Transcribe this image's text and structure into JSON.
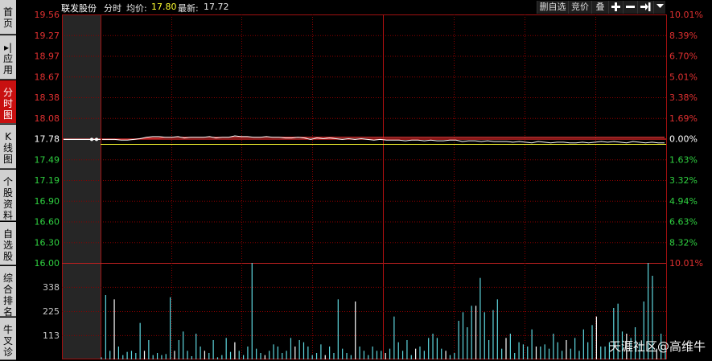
{
  "sidebar": {
    "tabs": [
      {
        "label": "首页",
        "active": false
      },
      {
        "label": "▸|应用",
        "active": false
      },
      {
        "label": "分时图",
        "active": true
      },
      {
        "label": "K线图",
        "active": false
      },
      {
        "label": "个股资料",
        "active": false
      },
      {
        "label": "自选股",
        "active": false
      },
      {
        "label": "综合排名",
        "active": false
      },
      {
        "label": "牛叉诊",
        "active": false
      }
    ]
  },
  "header": {
    "stock_name": "联发股份",
    "mode": "分时",
    "avg_label": "均价:",
    "avg_value": "17.80",
    "latest_label": "最新:",
    "latest_value": "17.72"
  },
  "toolbar": {
    "remove_watch": "删自选",
    "auction": "竞价",
    "overlay": "叠"
  },
  "watermark": "天涯社区@高维牛",
  "colors": {
    "up": "#e03030",
    "down": "#2fd040",
    "axis_white": "#c8c8c8",
    "grid": "#8b0000",
    "price_line": "#ffffff",
    "avg_line": "#ffff30",
    "volume_bar": "#5fd8e0"
  },
  "chart_data": {
    "type": "line",
    "prev_close": 17.78,
    "price_axis": {
      "left_ticks": [
        "19.56",
        "19.27",
        "18.97",
        "18.67",
        "18.38",
        "18.08",
        "17.78",
        "17.49",
        "17.19",
        "16.90",
        "16.60",
        "16.30",
        "16.00"
      ],
      "right_ticks": [
        "10.01%",
        "8.39%",
        "6.70%",
        "5.01%",
        "3.38%",
        "1.69%",
        "0.00%",
        "1.63%",
        "3.32%",
        "4.94%",
        "6.63%",
        "8.32%",
        "10.01%"
      ],
      "ylim": [
        16.0,
        19.56
      ]
    },
    "volume_axis": {
      "ticks": [
        "338",
        "225",
        "113"
      ],
      "ylim": [
        0,
        450
      ]
    },
    "price_series": [
      17.77,
      17.77,
      17.77,
      17.76,
      17.76,
      17.77,
      17.78,
      17.8,
      17.81,
      17.81,
      17.8,
      17.8,
      17.81,
      17.79,
      17.8,
      17.8,
      17.8,
      17.81,
      17.79,
      17.8,
      17.8,
      17.82,
      17.81,
      17.81,
      17.8,
      17.8,
      17.81,
      17.8,
      17.8,
      17.79,
      17.79,
      17.8,
      17.79,
      17.77,
      17.79,
      17.78,
      17.79,
      17.78,
      17.77,
      17.78,
      17.77,
      17.78,
      17.77,
      17.76,
      17.77,
      17.76,
      17.76,
      17.76,
      17.75,
      17.76,
      17.76,
      17.75,
      17.76,
      17.75,
      17.75,
      17.76,
      17.76,
      17.74,
      17.75,
      17.75,
      17.74,
      17.75,
      17.74,
      17.74,
      17.74,
      17.73,
      17.74,
      17.73,
      17.72,
      17.74,
      17.73,
      17.72,
      17.73,
      17.73,
      17.72,
      17.72,
      17.73,
      17.72,
      17.73,
      17.74,
      17.73,
      17.74,
      17.73,
      17.72,
      17.74,
      17.73,
      17.72,
      17.73,
      17.72,
      17.72
    ],
    "avg_series": [
      17.77,
      17.77,
      17.77,
      17.77,
      17.77,
      17.77,
      17.78,
      17.79,
      17.79,
      17.79,
      17.8,
      17.8,
      17.8,
      17.8,
      17.8,
      17.8,
      17.8,
      17.8,
      17.8,
      17.8,
      17.8,
      17.8,
      17.8,
      17.8,
      17.8,
      17.8,
      17.8,
      17.8,
      17.8,
      17.8,
      17.8,
      17.8,
      17.8,
      17.8,
      17.8,
      17.8,
      17.8,
      17.8,
      17.8,
      17.8,
      17.8,
      17.8,
      17.8,
      17.8,
      17.8,
      17.8,
      17.8,
      17.8,
      17.8,
      17.8,
      17.8,
      17.8,
      17.8,
      17.8,
      17.8,
      17.8,
      17.8,
      17.8,
      17.8,
      17.8,
      17.8,
      17.8,
      17.8,
      17.8,
      17.8,
      17.8,
      17.8,
      17.8,
      17.8,
      17.8,
      17.8,
      17.8,
      17.8,
      17.8,
      17.8,
      17.8,
      17.8,
      17.8,
      17.8,
      17.8,
      17.8,
      17.8,
      17.8,
      17.8,
      17.8,
      17.8,
      17.8,
      17.8,
      17.8,
      17.8
    ],
    "ref_line": 17.7,
    "volume_series": [
      10,
      300,
      40,
      280,
      60,
      20,
      35,
      40,
      30,
      170,
      40,
      90,
      20,
      30,
      20,
      25,
      290,
      40,
      90,
      130,
      40,
      15,
      120,
      60,
      40,
      30,
      90,
      10,
      20,
      100,
      35,
      80,
      40,
      20,
      60,
      450,
      50,
      30,
      20,
      40,
      70,
      60,
      30,
      40,
      100,
      60,
      90,
      80,
      60,
      20,
      30,
      70,
      20,
      60,
      30,
      280,
      50,
      30,
      20,
      270,
      60,
      40,
      20,
      60,
      40,
      40,
      30,
      50,
      200,
      80,
      40,
      90,
      20,
      50,
      60,
      40,
      100,
      120,
      100,
      50,
      40,
      20,
      30,
      180,
      220,
      150,
      250,
      250,
      380,
      220,
      90,
      230,
      280,
      50,
      100,
      120,
      30,
      80,
      70,
      60,
      140,
      60,
      60,
      70,
      50,
      120,
      80,
      40,
      90,
      50,
      100,
      40,
      140,
      80,
      160,
      200,
      60,
      60,
      80,
      240,
      260,
      130,
      120,
      100,
      150,
      80,
      270,
      450,
      390,
      50,
      120,
      60
    ],
    "cursor_index": 103
  }
}
